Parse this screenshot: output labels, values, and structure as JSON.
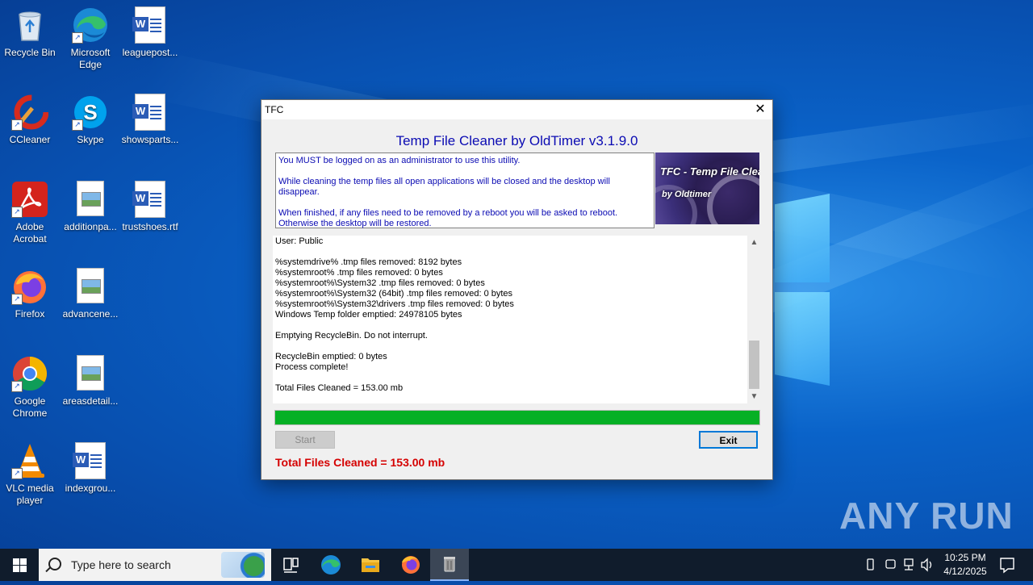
{
  "desktop": {
    "icons": [
      {
        "label": "Recycle Bin",
        "icon": "recycle-bin-icon"
      },
      {
        "label": "Microsoft Edge",
        "icon": "edge-icon"
      },
      {
        "label": "leaguepost...",
        "icon": "word-doc-icon"
      },
      {
        "label": "CCleaner",
        "icon": "ccleaner-icon"
      },
      {
        "label": "Skype",
        "icon": "skype-icon"
      },
      {
        "label": "showsparts...",
        "icon": "word-doc-icon"
      },
      {
        "label": "Adobe Acrobat",
        "icon": "acrobat-icon"
      },
      {
        "label": "additionpa...",
        "icon": "image-file-icon"
      },
      {
        "label": "trustshoes.rtf",
        "icon": "word-doc-icon"
      },
      {
        "label": "Firefox",
        "icon": "firefox-icon"
      },
      {
        "label": "advancene...",
        "icon": "image-file-icon"
      },
      {
        "label": "Google Chrome",
        "icon": "chrome-icon"
      },
      {
        "label": "areasdetail...",
        "icon": "image-file-icon"
      },
      {
        "label": "VLC media player",
        "icon": "vlc-icon"
      },
      {
        "label": "indexgrou...",
        "icon": "word-doc-icon"
      }
    ]
  },
  "dialog": {
    "window_title": "TFC",
    "close_glyph": "✕",
    "app_title": "Temp File Cleaner by OldTimer v3.1.9.0",
    "info": {
      "line1": "You MUST be logged on as an administrator to use this utility.",
      "line2": "While cleaning the temp files all open applications will be closed and the desktop will disappear.",
      "line3": "When finished, if any files need to be removed by a reboot you will be asked to reboot.",
      "line4": "Otherwise the desktop will be restored."
    },
    "banner": {
      "title": "TFC - Temp File Cleaner",
      "subtitle": "by Oldtimer"
    },
    "log": [
      "User: Public",
      "",
      "%systemdrive% .tmp files removed: 8192 bytes",
      "%systemroot% .tmp files removed: 0 bytes",
      "%systemroot%\\System32 .tmp files removed: 0 bytes",
      "%systemroot%\\System32 (64bit) .tmp files removed: 0 bytes",
      "%systemroot%\\System32\\drivers .tmp files removed: 0 bytes",
      "Windows Temp folder emptied: 24978105 bytes",
      "",
      "Emptying RecycleBin. Do not interrupt.",
      "",
      "RecycleBin emptied: 0 bytes",
      "Process complete!",
      "",
      "Total Files Cleaned = 153.00 mb"
    ],
    "progress_percent": 100,
    "progress_color": "#06b025",
    "start_label": "Start",
    "exit_label": "Exit",
    "total_label": "Total Files Cleaned = 153.00 mb",
    "total_color": "#d50000",
    "title_color": "#0b0bb3"
  },
  "watermark": "ANY RUN",
  "taskbar": {
    "search_placeholder": "Type here to search",
    "items": [
      "task-view-icon",
      "edge-icon",
      "file-explorer-icon",
      "firefox-icon",
      "tfc-app-icon"
    ],
    "clock_time": "10:25 PM",
    "clock_date": "4/12/2025"
  }
}
